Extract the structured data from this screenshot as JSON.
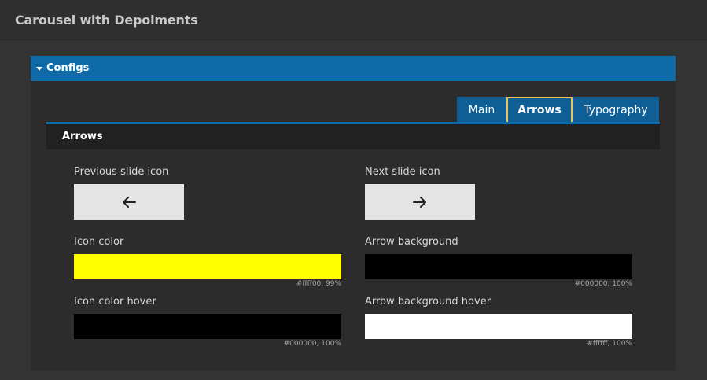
{
  "app": {
    "title": "Carousel with Depoiments"
  },
  "panel": {
    "title": "Configs"
  },
  "tabs": [
    {
      "label": "Main",
      "active": false
    },
    {
      "label": "Arrows",
      "active": true
    },
    {
      "label": "Typography",
      "active": false
    }
  ],
  "section": {
    "title": "Arrows"
  },
  "fields": {
    "prev_icon": {
      "label": "Previous slide icon",
      "icon": "arrow-left-icon"
    },
    "next_icon": {
      "label": "Next slide icon",
      "icon": "arrow-right-icon"
    },
    "icon_color": {
      "label": "Icon color",
      "color": "#ffff00",
      "value": "#ffff00, 99%"
    },
    "arrow_bg": {
      "label": "Arrow background",
      "color": "#000000",
      "value": "#000000, 100%"
    },
    "icon_color_hover": {
      "label": "Icon color hover",
      "color": "#000000",
      "value": "#000000, 100%"
    },
    "arrow_bg_hover": {
      "label": "Arrow background hover",
      "color": "#ffffff",
      "value": "#ffffff, 100%"
    }
  },
  "colors": {
    "accent": "#0f6aa8",
    "tab_focus": "#e8c45a"
  }
}
